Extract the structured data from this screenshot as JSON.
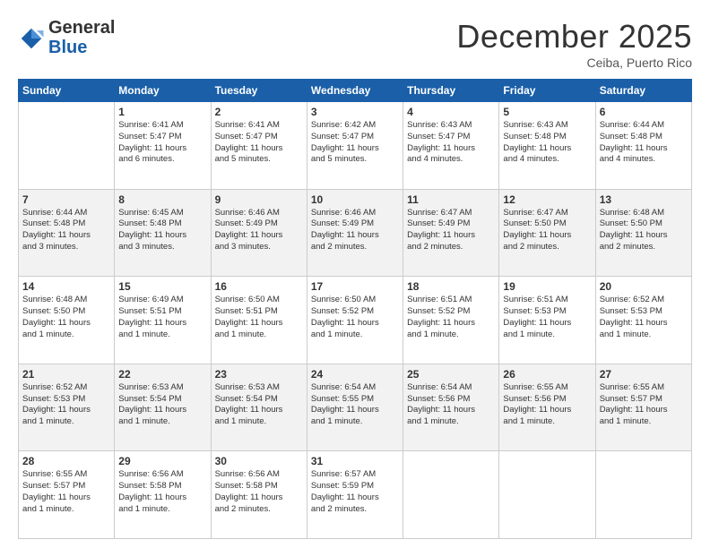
{
  "header": {
    "logo_general": "General",
    "logo_blue": "Blue",
    "month_title": "December 2025",
    "subtitle": "Ceiba, Puerto Rico"
  },
  "days_of_week": [
    "Sunday",
    "Monday",
    "Tuesday",
    "Wednesday",
    "Thursday",
    "Friday",
    "Saturday"
  ],
  "weeks": [
    [
      {
        "num": "",
        "info": ""
      },
      {
        "num": "1",
        "info": "Sunrise: 6:41 AM\nSunset: 5:47 PM\nDaylight: 11 hours\nand 6 minutes."
      },
      {
        "num": "2",
        "info": "Sunrise: 6:41 AM\nSunset: 5:47 PM\nDaylight: 11 hours\nand 5 minutes."
      },
      {
        "num": "3",
        "info": "Sunrise: 6:42 AM\nSunset: 5:47 PM\nDaylight: 11 hours\nand 5 minutes."
      },
      {
        "num": "4",
        "info": "Sunrise: 6:43 AM\nSunset: 5:47 PM\nDaylight: 11 hours\nand 4 minutes."
      },
      {
        "num": "5",
        "info": "Sunrise: 6:43 AM\nSunset: 5:48 PM\nDaylight: 11 hours\nand 4 minutes."
      },
      {
        "num": "6",
        "info": "Sunrise: 6:44 AM\nSunset: 5:48 PM\nDaylight: 11 hours\nand 4 minutes."
      }
    ],
    [
      {
        "num": "7",
        "info": "Sunrise: 6:44 AM\nSunset: 5:48 PM\nDaylight: 11 hours\nand 3 minutes."
      },
      {
        "num": "8",
        "info": "Sunrise: 6:45 AM\nSunset: 5:48 PM\nDaylight: 11 hours\nand 3 minutes."
      },
      {
        "num": "9",
        "info": "Sunrise: 6:46 AM\nSunset: 5:49 PM\nDaylight: 11 hours\nand 3 minutes."
      },
      {
        "num": "10",
        "info": "Sunrise: 6:46 AM\nSunset: 5:49 PM\nDaylight: 11 hours\nand 2 minutes."
      },
      {
        "num": "11",
        "info": "Sunrise: 6:47 AM\nSunset: 5:49 PM\nDaylight: 11 hours\nand 2 minutes."
      },
      {
        "num": "12",
        "info": "Sunrise: 6:47 AM\nSunset: 5:50 PM\nDaylight: 11 hours\nand 2 minutes."
      },
      {
        "num": "13",
        "info": "Sunrise: 6:48 AM\nSunset: 5:50 PM\nDaylight: 11 hours\nand 2 minutes."
      }
    ],
    [
      {
        "num": "14",
        "info": "Sunrise: 6:48 AM\nSunset: 5:50 PM\nDaylight: 11 hours\nand 1 minute."
      },
      {
        "num": "15",
        "info": "Sunrise: 6:49 AM\nSunset: 5:51 PM\nDaylight: 11 hours\nand 1 minute."
      },
      {
        "num": "16",
        "info": "Sunrise: 6:50 AM\nSunset: 5:51 PM\nDaylight: 11 hours\nand 1 minute."
      },
      {
        "num": "17",
        "info": "Sunrise: 6:50 AM\nSunset: 5:52 PM\nDaylight: 11 hours\nand 1 minute."
      },
      {
        "num": "18",
        "info": "Sunrise: 6:51 AM\nSunset: 5:52 PM\nDaylight: 11 hours\nand 1 minute."
      },
      {
        "num": "19",
        "info": "Sunrise: 6:51 AM\nSunset: 5:53 PM\nDaylight: 11 hours\nand 1 minute."
      },
      {
        "num": "20",
        "info": "Sunrise: 6:52 AM\nSunset: 5:53 PM\nDaylight: 11 hours\nand 1 minute."
      }
    ],
    [
      {
        "num": "21",
        "info": "Sunrise: 6:52 AM\nSunset: 5:53 PM\nDaylight: 11 hours\nand 1 minute."
      },
      {
        "num": "22",
        "info": "Sunrise: 6:53 AM\nSunset: 5:54 PM\nDaylight: 11 hours\nand 1 minute."
      },
      {
        "num": "23",
        "info": "Sunrise: 6:53 AM\nSunset: 5:54 PM\nDaylight: 11 hours\nand 1 minute."
      },
      {
        "num": "24",
        "info": "Sunrise: 6:54 AM\nSunset: 5:55 PM\nDaylight: 11 hours\nand 1 minute."
      },
      {
        "num": "25",
        "info": "Sunrise: 6:54 AM\nSunset: 5:56 PM\nDaylight: 11 hours\nand 1 minute."
      },
      {
        "num": "26",
        "info": "Sunrise: 6:55 AM\nSunset: 5:56 PM\nDaylight: 11 hours\nand 1 minute."
      },
      {
        "num": "27",
        "info": "Sunrise: 6:55 AM\nSunset: 5:57 PM\nDaylight: 11 hours\nand 1 minute."
      }
    ],
    [
      {
        "num": "28",
        "info": "Sunrise: 6:55 AM\nSunset: 5:57 PM\nDaylight: 11 hours\nand 1 minute."
      },
      {
        "num": "29",
        "info": "Sunrise: 6:56 AM\nSunset: 5:58 PM\nDaylight: 11 hours\nand 1 minute."
      },
      {
        "num": "30",
        "info": "Sunrise: 6:56 AM\nSunset: 5:58 PM\nDaylight: 11 hours\nand 2 minutes."
      },
      {
        "num": "31",
        "info": "Sunrise: 6:57 AM\nSunset: 5:59 PM\nDaylight: 11 hours\nand 2 minutes."
      },
      {
        "num": "",
        "info": ""
      },
      {
        "num": "",
        "info": ""
      },
      {
        "num": "",
        "info": ""
      }
    ]
  ]
}
